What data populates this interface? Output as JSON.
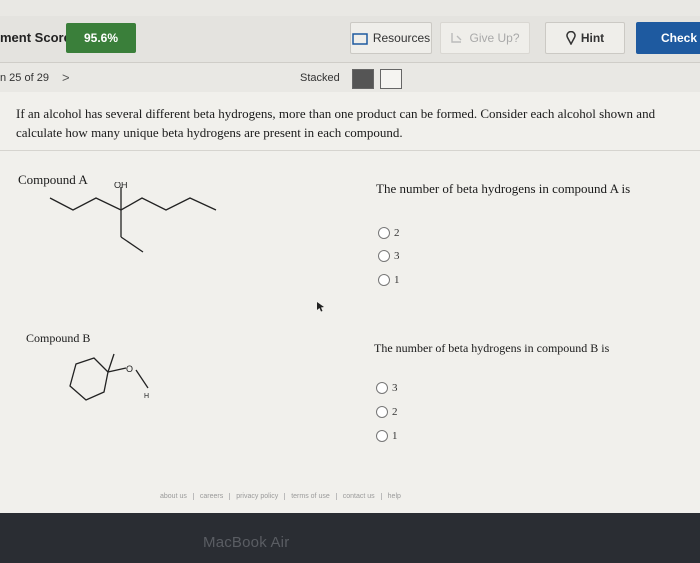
{
  "header": {
    "score_label": "ment Score:",
    "score_value": "95.6%",
    "resources_label": "Resources",
    "give_up_label": "Give Up?",
    "hint_label": "Hint",
    "check_label": "Check A"
  },
  "nav": {
    "question_number": "n 25 of 29",
    "next_symbol": ">",
    "stacked_label": "Stacked"
  },
  "question": {
    "text": "If an alcohol has several different beta hydrogens, more than one product can be formed. Consider each alcohol shown and calculate how many unique beta hydrogens are present in each compound."
  },
  "compound_a": {
    "label": "Compound A",
    "oh_label": "OH",
    "prompt": "The number of beta hydrogens in compound A is",
    "options": [
      "2",
      "3",
      "1"
    ]
  },
  "compound_b": {
    "label": "Compound B",
    "o_label": "O",
    "h_label": "H",
    "prompt": "The number of beta hydrogens in compound B is",
    "options": [
      "3",
      "2",
      "1"
    ]
  },
  "footer": {
    "links": [
      "about us",
      "careers",
      "privacy policy",
      "terms of use",
      "contact us",
      "help"
    ]
  },
  "device_label": "MacBook Air"
}
